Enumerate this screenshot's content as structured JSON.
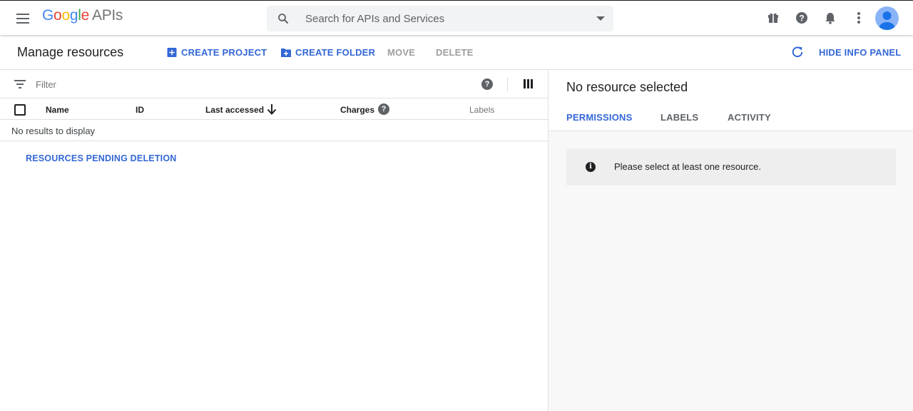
{
  "header": {
    "logo": {
      "G": "G",
      "o1": "o",
      "o2": "o",
      "g": "g",
      "l": "l",
      "e": "e",
      "suffix": "APIs"
    },
    "search": {
      "placeholder": "Search for APIs and Services",
      "value": ""
    },
    "icons": [
      "menu-icon",
      "search-icon",
      "chevron-down-icon",
      "gift-icon",
      "help-icon",
      "bell-icon",
      "more-vert-icon",
      "avatar"
    ]
  },
  "actionbar": {
    "title": "Manage resources",
    "create_project": "CREATE PROJECT",
    "create_folder": "CREATE FOLDER",
    "move": "MOVE",
    "delete": "DELETE",
    "hide_info_panel": "HIDE INFO PANEL"
  },
  "table": {
    "filter_placeholder": "Filter",
    "columns": {
      "name": "Name",
      "id": "ID",
      "last_accessed": "Last accessed",
      "charges": "Charges",
      "labels": "Labels"
    },
    "charges_help": "?",
    "empty_text": "No results to display",
    "pending_link": "RESOURCES PENDING DELETION"
  },
  "info_panel": {
    "title": "No resource selected",
    "tabs": {
      "permissions": "PERMISSIONS",
      "labels": "LABELS",
      "activity": "ACTIVITY"
    },
    "active_tab": "PERMISSIONS",
    "notice_icon": "i",
    "notice": "Please select at least one resource."
  },
  "colors": {
    "accent": "#3367d6",
    "disabled": "#9e9e9e",
    "panel_bg": "#f8f8f8",
    "notice_bg": "#eeeeee"
  }
}
